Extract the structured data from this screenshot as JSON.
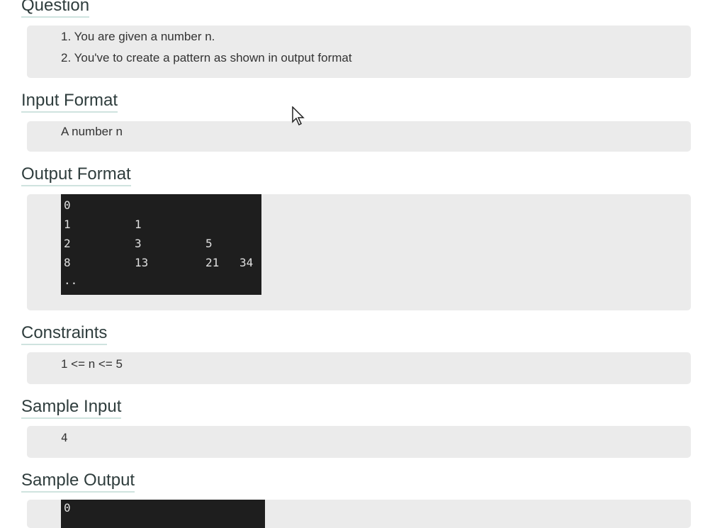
{
  "sections": {
    "question": {
      "heading": "Question",
      "lines": [
        "1. You are given a number n.",
        "2. You've to create a pattern as shown in output format"
      ]
    },
    "input_format": {
      "heading": "Input Format",
      "text": "A number n"
    },
    "output_format": {
      "heading": "Output Format",
      "terminal_rows": [
        [
          "0"
        ],
        [
          "1",
          "1"
        ],
        [
          "2",
          "3",
          "5"
        ],
        [
          "8",
          "13",
          "21",
          "34"
        ],
        [
          ".."
        ]
      ]
    },
    "constraints": {
      "heading": "Constraints",
      "text": "1 <= n <= 5"
    },
    "sample_input": {
      "heading": "Sample Input",
      "text": "4"
    },
    "sample_output": {
      "heading": "Sample Output",
      "terminal_rows": [
        [
          "0"
        ]
      ]
    }
  }
}
